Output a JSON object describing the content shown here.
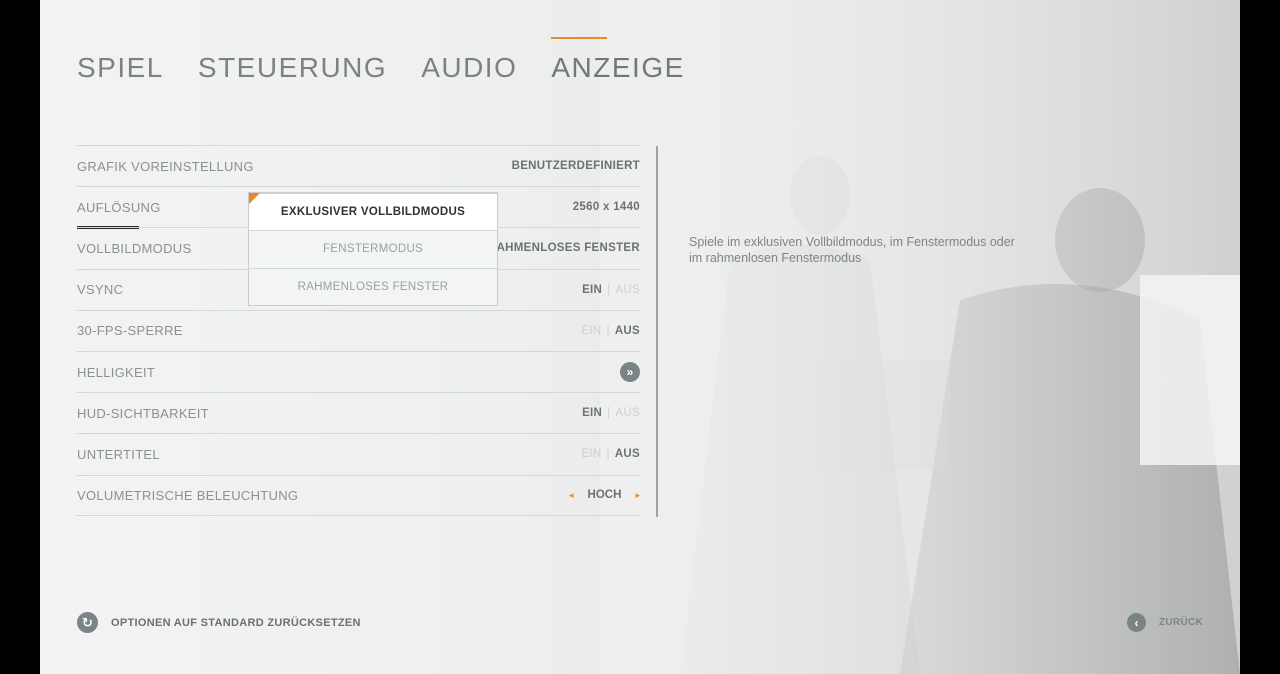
{
  "tabs": [
    {
      "label": "SPIEL"
    },
    {
      "label": "STEUERUNG"
    },
    {
      "label": "AUDIO"
    },
    {
      "label": "ANZEIGE"
    }
  ],
  "settings": {
    "grafik": {
      "label": "GRAFIK VOREINSTELLUNG",
      "value": "BENUTZERDEFINIERT"
    },
    "aufloesung": {
      "label": "AUFLÖSUNG",
      "value": "2560 x 1440"
    },
    "vollbild": {
      "label": "VOLLBILDMODUS",
      "value": "RAHMENLOSES FENSTER"
    },
    "vsync": {
      "label": "VSYNC",
      "on": "EIN",
      "off": "AUS",
      "selected": "EIN"
    },
    "fps": {
      "label": "30-FPS-SPERRE",
      "on": "EIN",
      "off": "AUS",
      "selected": "AUS"
    },
    "helligkeit": {
      "label": "HELLIGKEIT",
      "icon": "double-chevron-right-icon"
    },
    "hud": {
      "label": "HUD-SICHTBARKEIT",
      "on": "EIN",
      "off": "AUS",
      "selected": "EIN"
    },
    "untertitel": {
      "label": "UNTERTITEL",
      "on": "EIN",
      "off": "AUS",
      "selected": "AUS"
    },
    "volumetrisch": {
      "label": "VOLUMETRISCHE BELEUCHTUNG",
      "value": "HOCH"
    }
  },
  "dropdown": {
    "options": [
      "EXKLUSIVER VOLLBILDMODUS",
      "FENSTERMODUS",
      "RAHMENLOSES FENSTER"
    ],
    "highlighted": "EXKLUSIVER VOLLBILDMODUS"
  },
  "description": "Spiele im exklusiven Vollbildmodus, im Fenstermodus oder im rahmenlosen Fenstermodus",
  "footer": {
    "reset_label": "OPTIONEN AUF STANDARD ZURÜCKSETZEN",
    "back_label": "ZURÜCK"
  },
  "colors": {
    "accent": "#e68a2e",
    "text": "#6a7376",
    "dim": "#ccd0d1"
  }
}
